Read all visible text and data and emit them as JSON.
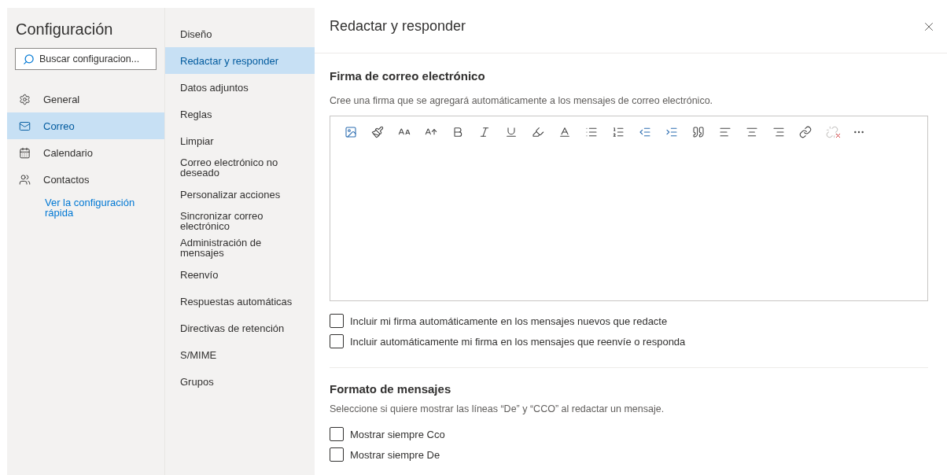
{
  "sidebar": {
    "title": "Configuración",
    "search": {
      "placeholder": "Buscar configuracion..."
    },
    "items": [
      {
        "kind": "settings",
        "label": "General",
        "selected": false
      },
      {
        "kind": "mail",
        "label": "Correo",
        "selected": true
      },
      {
        "kind": "calendar",
        "label": "Calendario",
        "selected": false
      },
      {
        "kind": "contacts",
        "label": "Contactos",
        "selected": false
      }
    ],
    "link": "Ver la configuración rápida"
  },
  "subnav": {
    "items": [
      {
        "label": "Diseño",
        "selected": false
      },
      {
        "label": "Redactar y responder",
        "selected": true
      },
      {
        "label": "Datos adjuntos",
        "selected": false
      },
      {
        "label": "Reglas",
        "selected": false
      },
      {
        "label": "Limpiar",
        "selected": false
      },
      {
        "label": "Correo electrónico no deseado",
        "selected": false
      },
      {
        "label": "Personalizar acciones",
        "selected": false
      },
      {
        "label": "Sincronizar correo electrónico",
        "selected": false
      },
      {
        "label": "Administración de mensajes",
        "selected": false
      },
      {
        "label": "Reenvío",
        "selected": false
      },
      {
        "label": "Respuestas automáticas",
        "selected": false
      },
      {
        "label": "Directivas de retención",
        "selected": false
      },
      {
        "label": "S/MIME",
        "selected": false
      },
      {
        "label": "Grupos",
        "selected": false
      }
    ]
  },
  "panel": {
    "title": "Redactar y responder",
    "signature": {
      "heading": "Firma de correo electrónico",
      "description": "Cree una firma que se agregará automáticamente a los mensajes de correo electrónico.",
      "toolbar": [
        {
          "kind": "image",
          "disabled": false
        },
        {
          "kind": "brush",
          "disabled": false
        },
        {
          "kind": "font-size",
          "disabled": false
        },
        {
          "kind": "grow",
          "disabled": false
        },
        {
          "kind": "bold",
          "disabled": false
        },
        {
          "kind": "italic",
          "disabled": false
        },
        {
          "kind": "underline",
          "disabled": false
        },
        {
          "kind": "highlight",
          "disabled": false
        },
        {
          "kind": "font-color",
          "disabled": false
        },
        {
          "kind": "bullets",
          "disabled": false
        },
        {
          "kind": "numbering",
          "disabled": false
        },
        {
          "kind": "outdent",
          "disabled": false
        },
        {
          "kind": "indent",
          "disabled": false
        },
        {
          "kind": "quote",
          "disabled": false
        },
        {
          "kind": "align-left",
          "disabled": false
        },
        {
          "kind": "align-center",
          "disabled": false
        },
        {
          "kind": "align-right",
          "disabled": false
        },
        {
          "kind": "link",
          "disabled": false
        },
        {
          "kind": "unlink",
          "disabled": true
        },
        {
          "kind": "more",
          "disabled": false
        }
      ],
      "options": [
        {
          "label": "Incluir mi firma automáticamente en los mensajes nuevos que redacte",
          "checked": false
        },
        {
          "label": "Incluir automáticamente mi firma en los mensajes que reenvíe o responda",
          "checked": false
        }
      ]
    },
    "format": {
      "heading": "Formato de mensajes",
      "description": "Seleccione si quiere mostrar las líneas “De” y “CCO” al redactar un mensaje.",
      "options": [
        {
          "label": "Mostrar siempre Cco",
          "checked": false
        },
        {
          "label": "Mostrar siempre De",
          "checked": false
        }
      ]
    }
  }
}
